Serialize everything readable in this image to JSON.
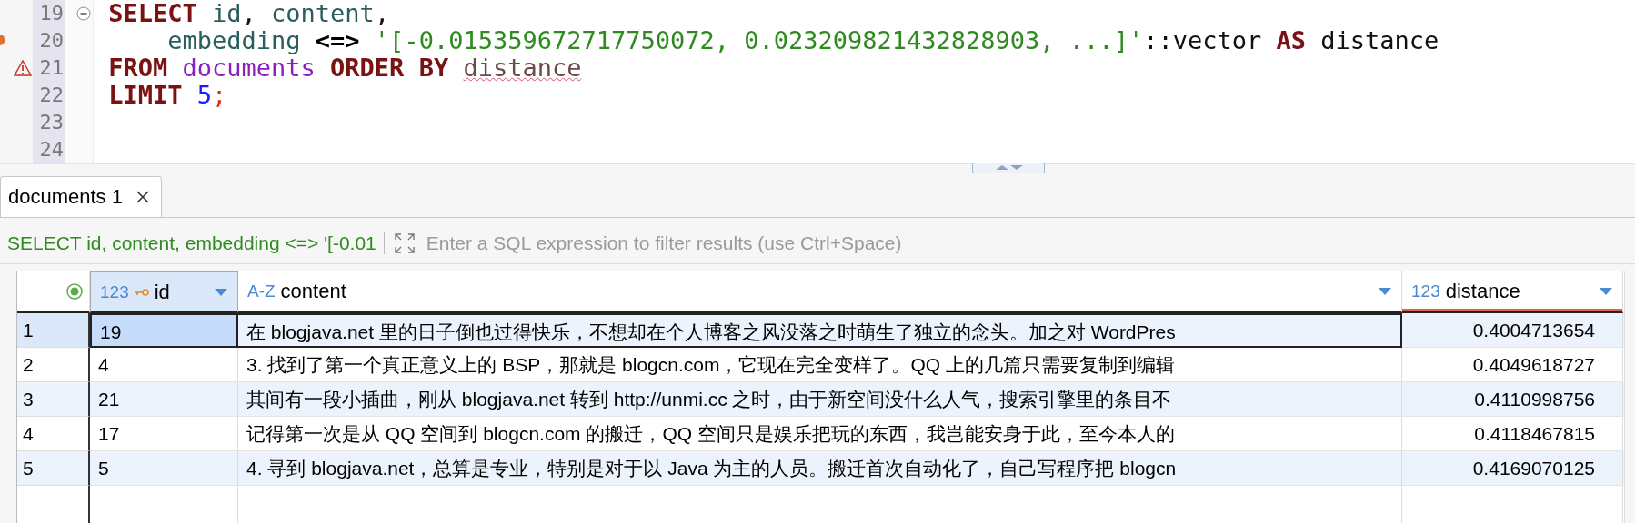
{
  "editor": {
    "lines": [
      {
        "number": "19",
        "foldable": true,
        "warning": false,
        "changed": false,
        "indented": false,
        "tokens": [
          {
            "kind": "keyword",
            "text": "SELECT",
            "attached": false
          },
          {
            "kind": "identifier",
            "text": "id",
            "attached": false
          },
          {
            "kind": "punct",
            "text": ",",
            "attached": true
          },
          {
            "kind": "identifier",
            "text": "content",
            "attached": false
          },
          {
            "kind": "punct",
            "text": ",",
            "attached": true
          }
        ]
      },
      {
        "number": "20",
        "foldable": false,
        "warning": false,
        "changed": true,
        "indented": true,
        "tokens": [
          {
            "kind": "identifier",
            "text": "embedding",
            "attached": false
          },
          {
            "kind": "operator",
            "text": "<=>",
            "attached": false
          },
          {
            "kind": "string",
            "text": "'[-0.015359672717750072, 0.023209821432828903, ...]'",
            "attached": false
          },
          {
            "kind": "plain",
            "text": "::vector",
            "attached": true
          },
          {
            "kind": "keyword",
            "text": "AS",
            "attached": false
          },
          {
            "kind": "plain",
            "text": "distance",
            "attached": false
          }
        ]
      },
      {
        "number": "21",
        "foldable": false,
        "warning": true,
        "changed": false,
        "indented": false,
        "tokens": [
          {
            "kind": "keyword",
            "text": "FROM",
            "attached": false
          },
          {
            "kind": "table",
            "text": "documents",
            "attached": false
          },
          {
            "kind": "keyword",
            "text": "ORDER BY",
            "attached": false
          },
          {
            "kind": "unresolved",
            "text": "distance",
            "attached": false
          }
        ]
      },
      {
        "number": "22",
        "foldable": false,
        "warning": false,
        "changed": false,
        "indented": false,
        "tokens": [
          {
            "kind": "keyword",
            "text": "LIMIT",
            "attached": false
          },
          {
            "kind": "number",
            "text": "5",
            "attached": false
          },
          {
            "kind": "end",
            "text": ";",
            "attached": true
          }
        ]
      },
      {
        "number": "23",
        "foldable": false,
        "warning": false,
        "changed": false,
        "indented": false
      },
      {
        "number": "24",
        "foldable": false,
        "warning": false,
        "changed": false,
        "indented": false
      }
    ]
  },
  "result_tabs": [
    {
      "label": "documents 1",
      "selected": true,
      "closable": true
    }
  ],
  "filter": {
    "query": "SELECT id, content, embedding <=> '[-0.01",
    "placeholder": "Enter a SQL expression to filter results (use Ctrl+Space)"
  },
  "table": {
    "columns": [
      {
        "type_label": "123",
        "name": "id",
        "key": true,
        "sorted": false
      },
      {
        "type_label": "A-Z",
        "name": "content",
        "key": false,
        "sorted": false
      },
      {
        "type_label": "123",
        "name": "distance",
        "key": false,
        "sorted": true
      }
    ],
    "rows": [
      {
        "number": "1",
        "selected": true,
        "cells": [
          "19",
          "在 blogjava.net 里的日子倒也过得快乐，不想却在个人博客之风没落之时萌生了独立的念头。加之对 WordPres",
          "0.4004713654"
        ]
      },
      {
        "number": "2",
        "selected": false,
        "cells": [
          "4",
          "3. 找到了第一个真正意义上的 BSP，那就是 blogcn.com，它现在完全变样了。QQ 上的几篇只需要复制到编辑",
          "0.4049618727"
        ]
      },
      {
        "number": "3",
        "selected": false,
        "cells": [
          "21",
          "其间有一段小插曲，刚从 blogjava.net 转到 http://unmi.cc 之时，由于新空间没什么人气，搜索引擎里的条目不",
          "0.4110998756"
        ]
      },
      {
        "number": "4",
        "selected": false,
        "cells": [
          "17",
          "记得第一次是从 QQ 空间到 blogcn.com 的搬迁，QQ 空间只是娱乐把玩的东西，我岂能安身于此，至今本人的",
          "0.4118467815"
        ]
      },
      {
        "number": "5",
        "selected": false,
        "cells": [
          "5",
          "4. 寻到 blogjava.net，总算是专业，特别是对于以 Java 为主的人员。搬迁首次自动化了，自己写程序把 blogcn",
          "0.4169070125"
        ]
      }
    ]
  }
}
